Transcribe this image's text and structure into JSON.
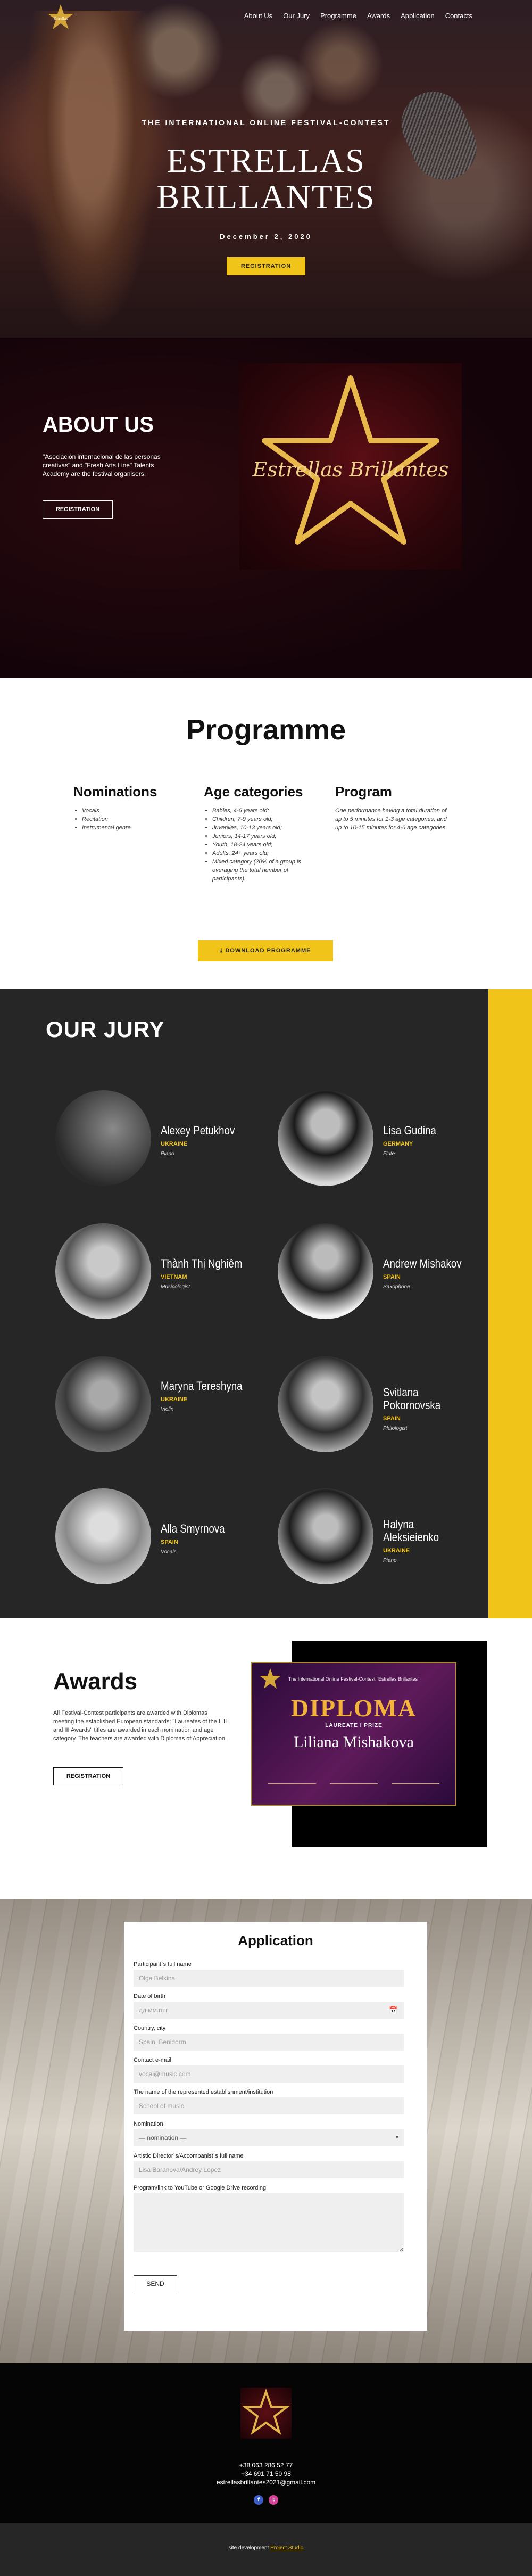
{
  "nav": {
    "links": [
      "About Us",
      "Our Jury",
      "Programme",
      "Awards",
      "Application",
      "Contacts"
    ]
  },
  "hero": {
    "subtitle": "THE INTERNATIONAL ONLINE FESTIVAL-CONTEST",
    "title_line1": "ESTRELLAS",
    "title_line2": "BRILLANTES",
    "date": "December 2, 2020",
    "button": "REGISTRATION"
  },
  "about": {
    "title": "ABOUT US",
    "text": "\"Asociación internacional de las personas creativas\" and \"Fresh Arts Line\" Talents Academy are the festival organisers.",
    "button": "REGISTRATION",
    "image_script": "Estrellas Brillantes"
  },
  "programme": {
    "title": "Programme",
    "nominations": {
      "heading": "Nominations",
      "items": [
        "Vocals",
        "Recitation",
        "Instrumental genre"
      ]
    },
    "age_categories": {
      "heading": "Age categories",
      "items": [
        "Babies, 4-6 years old;",
        "Children, 7-9 years old;",
        "Juveniles, 10-13 years old;",
        "Juniors, 14-17 years old;",
        "Youth, 18-24 years old;",
        "Adults, 24+ years old;",
        "Mixed category (20% of a group is overaging the total number of participants)."
      ]
    },
    "program": {
      "heading": "Program",
      "text": "One performance having a total duration of up to 5 minutes for 1-3 age categories, and up to 10-15 minutes for 4-6 age categories"
    },
    "download_button": "DOWNLOAD PROGRAMME"
  },
  "jury": {
    "title": "OUR JURY",
    "members": [
      {
        "name": "Alexey Petukhov",
        "country": "UKRAINE",
        "instrument": "Piano"
      },
      {
        "name": "Lisa Gudina",
        "country": "GERMANY",
        "instrument": "Flute"
      },
      {
        "name": "Thành Thị Nghiêm",
        "country": "VIETNAM",
        "instrument": "Musicologist"
      },
      {
        "name": "Andrew Mishakov",
        "country": "SPAIN",
        "instrument": "Saxophone"
      },
      {
        "name": "Maryna Tereshyna",
        "country": "UKRAINE",
        "instrument": "Violin"
      },
      {
        "name": "Svitlana Pokornovska",
        "country": "SPAIN",
        "instrument": "Philologist"
      },
      {
        "name": "Alla Smyrnova",
        "country": "SPAIN",
        "instrument": "Vocals"
      },
      {
        "name": "Halyna Aleksieienko",
        "country": "UKRAINE",
        "instrument": "Piano"
      }
    ]
  },
  "awards": {
    "title": "Awards",
    "text": "All Festival-Contest participants are awarded with Diplomas meeting the established European standards: \"Laureates of the I, II and III Awards\" titles are awarded in each nomination and age category. The teachers are awarded with Diplomas of Appreciation.",
    "button": "REGISTRATION",
    "diploma": {
      "header": "The International Online Festival-Contest \"Estrellas Brillantes\"",
      "title": "DIPLOMA",
      "laureate": "LAUREATE  I  PRIZE",
      "name": "Liliana Mishakova"
    }
  },
  "application": {
    "title": "Application",
    "fields": [
      {
        "label": "Participant`s full name",
        "placeholder": "Olga Belkina"
      },
      {
        "label": "Date of birth",
        "placeholder": "дд.мм.гггг"
      },
      {
        "label": "Country, city",
        "placeholder": "Spain, Benidorm"
      },
      {
        "label": "Contact e-mail",
        "placeholder": "vocal@music.com"
      },
      {
        "label": "The name of the represented establishment/institution",
        "placeholder": "School of music"
      },
      {
        "label": "Nomination",
        "placeholder": "— nomination —"
      },
      {
        "label": "Artistic Director`s/Accompanist`s full name",
        "placeholder": "Lisa Baranova/Andrey Lopez"
      },
      {
        "label": "Program/link to YouTube or Google Drive recording",
        "placeholder": ""
      }
    ],
    "send": "SEND"
  },
  "footer": {
    "phone1": "+38 063 286 52 77",
    "phone2": "+34 691 71 50 98",
    "email": "estrellasbrillantes2021@gmail.com",
    "social": [
      "f",
      "ig"
    ]
  },
  "bottom": {
    "text": "site development",
    "link": "Project Studio"
  }
}
